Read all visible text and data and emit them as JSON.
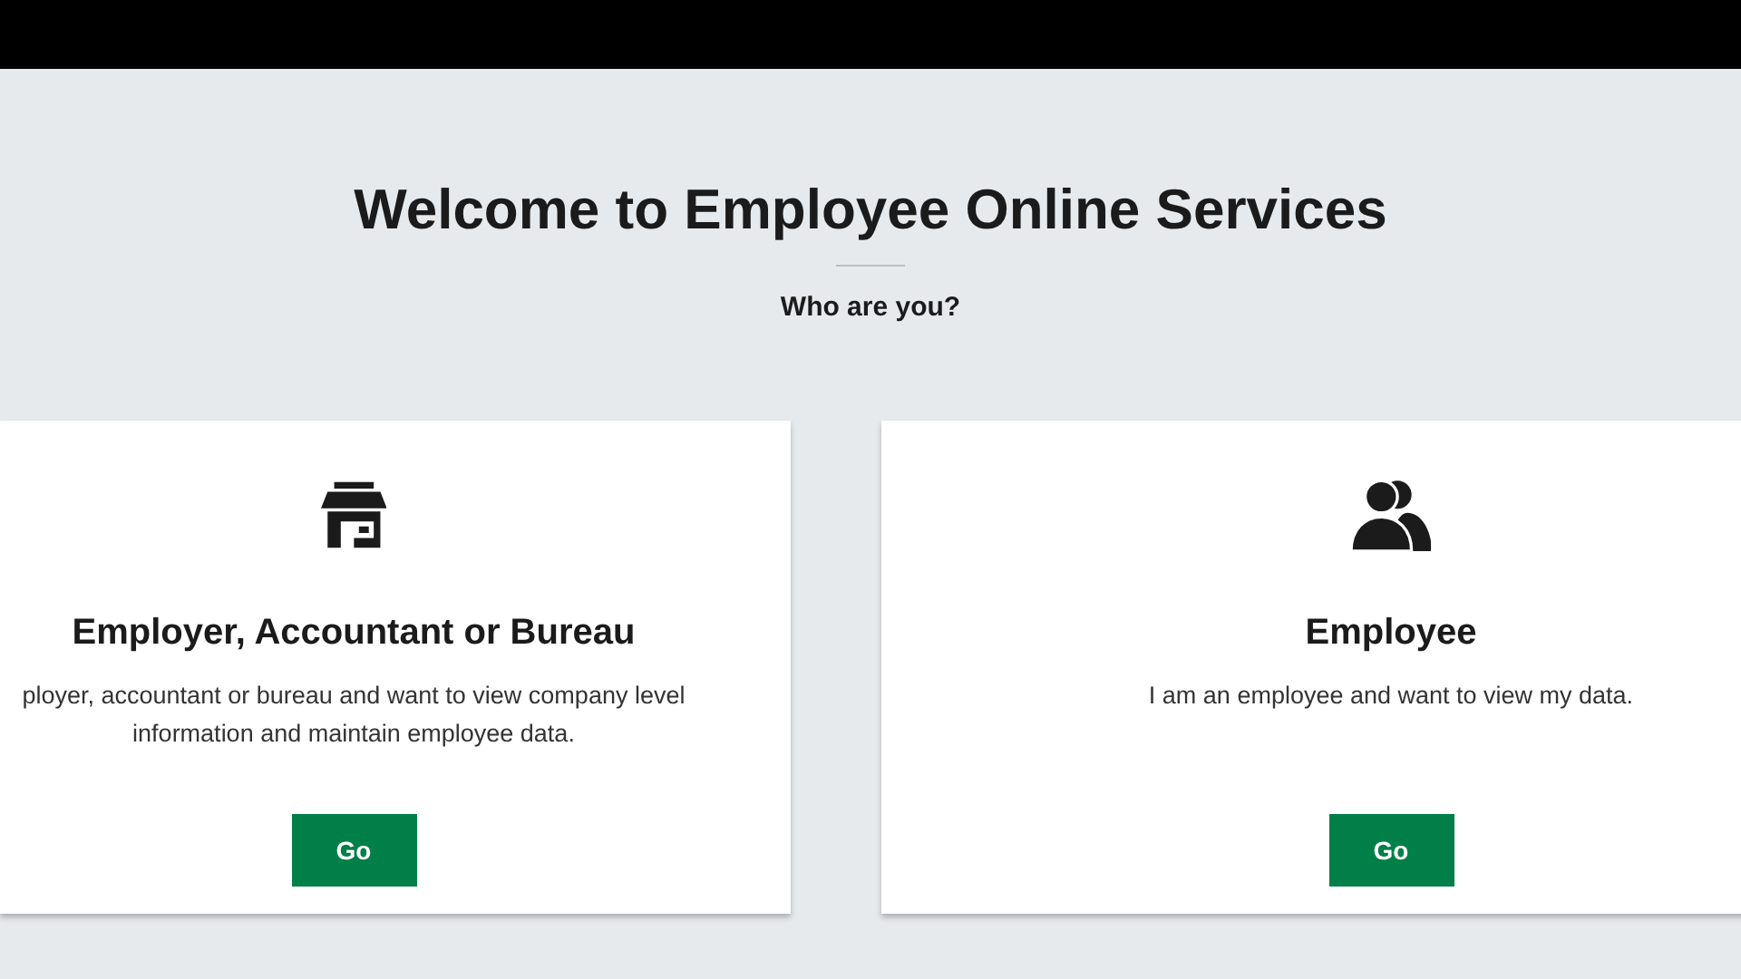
{
  "title": "Welcome to Employee Online Services",
  "subtitle": "Who are you?",
  "cards": [
    {
      "kind": "store",
      "heading": "Employer, Accountant or Bureau",
      "description": "ployer, accountant or bureau and want to view company level information and maintain employee data.",
      "button": "Go"
    },
    {
      "kind": "people",
      "heading": "Employee",
      "description": "I am an employee and want to view my data.",
      "button": "Go"
    }
  ]
}
